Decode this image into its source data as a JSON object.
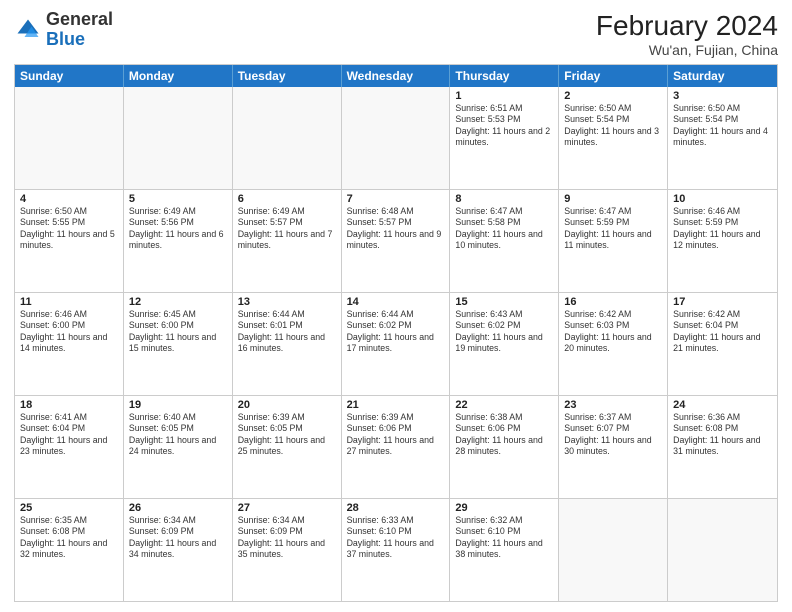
{
  "header": {
    "logo_general": "General",
    "logo_blue": "Blue",
    "month_year": "February 2024",
    "location": "Wu'an, Fujian, China"
  },
  "days_of_week": [
    "Sunday",
    "Monday",
    "Tuesday",
    "Wednesday",
    "Thursday",
    "Friday",
    "Saturday"
  ],
  "weeks": [
    [
      {
        "day": "",
        "info": ""
      },
      {
        "day": "",
        "info": ""
      },
      {
        "day": "",
        "info": ""
      },
      {
        "day": "",
        "info": ""
      },
      {
        "day": "1",
        "info": "Sunrise: 6:51 AM\nSunset: 5:53 PM\nDaylight: 11 hours and 2 minutes."
      },
      {
        "day": "2",
        "info": "Sunrise: 6:50 AM\nSunset: 5:54 PM\nDaylight: 11 hours and 3 minutes."
      },
      {
        "day": "3",
        "info": "Sunrise: 6:50 AM\nSunset: 5:54 PM\nDaylight: 11 hours and 4 minutes."
      }
    ],
    [
      {
        "day": "4",
        "info": "Sunrise: 6:50 AM\nSunset: 5:55 PM\nDaylight: 11 hours and 5 minutes."
      },
      {
        "day": "5",
        "info": "Sunrise: 6:49 AM\nSunset: 5:56 PM\nDaylight: 11 hours and 6 minutes."
      },
      {
        "day": "6",
        "info": "Sunrise: 6:49 AM\nSunset: 5:57 PM\nDaylight: 11 hours and 7 minutes."
      },
      {
        "day": "7",
        "info": "Sunrise: 6:48 AM\nSunset: 5:57 PM\nDaylight: 11 hours and 9 minutes."
      },
      {
        "day": "8",
        "info": "Sunrise: 6:47 AM\nSunset: 5:58 PM\nDaylight: 11 hours and 10 minutes."
      },
      {
        "day": "9",
        "info": "Sunrise: 6:47 AM\nSunset: 5:59 PM\nDaylight: 11 hours and 11 minutes."
      },
      {
        "day": "10",
        "info": "Sunrise: 6:46 AM\nSunset: 5:59 PM\nDaylight: 11 hours and 12 minutes."
      }
    ],
    [
      {
        "day": "11",
        "info": "Sunrise: 6:46 AM\nSunset: 6:00 PM\nDaylight: 11 hours and 14 minutes."
      },
      {
        "day": "12",
        "info": "Sunrise: 6:45 AM\nSunset: 6:00 PM\nDaylight: 11 hours and 15 minutes."
      },
      {
        "day": "13",
        "info": "Sunrise: 6:44 AM\nSunset: 6:01 PM\nDaylight: 11 hours and 16 minutes."
      },
      {
        "day": "14",
        "info": "Sunrise: 6:44 AM\nSunset: 6:02 PM\nDaylight: 11 hours and 17 minutes."
      },
      {
        "day": "15",
        "info": "Sunrise: 6:43 AM\nSunset: 6:02 PM\nDaylight: 11 hours and 19 minutes."
      },
      {
        "day": "16",
        "info": "Sunrise: 6:42 AM\nSunset: 6:03 PM\nDaylight: 11 hours and 20 minutes."
      },
      {
        "day": "17",
        "info": "Sunrise: 6:42 AM\nSunset: 6:04 PM\nDaylight: 11 hours and 21 minutes."
      }
    ],
    [
      {
        "day": "18",
        "info": "Sunrise: 6:41 AM\nSunset: 6:04 PM\nDaylight: 11 hours and 23 minutes."
      },
      {
        "day": "19",
        "info": "Sunrise: 6:40 AM\nSunset: 6:05 PM\nDaylight: 11 hours and 24 minutes."
      },
      {
        "day": "20",
        "info": "Sunrise: 6:39 AM\nSunset: 6:05 PM\nDaylight: 11 hours and 25 minutes."
      },
      {
        "day": "21",
        "info": "Sunrise: 6:39 AM\nSunset: 6:06 PM\nDaylight: 11 hours and 27 minutes."
      },
      {
        "day": "22",
        "info": "Sunrise: 6:38 AM\nSunset: 6:06 PM\nDaylight: 11 hours and 28 minutes."
      },
      {
        "day": "23",
        "info": "Sunrise: 6:37 AM\nSunset: 6:07 PM\nDaylight: 11 hours and 30 minutes."
      },
      {
        "day": "24",
        "info": "Sunrise: 6:36 AM\nSunset: 6:08 PM\nDaylight: 11 hours and 31 minutes."
      }
    ],
    [
      {
        "day": "25",
        "info": "Sunrise: 6:35 AM\nSunset: 6:08 PM\nDaylight: 11 hours and 32 minutes."
      },
      {
        "day": "26",
        "info": "Sunrise: 6:34 AM\nSunset: 6:09 PM\nDaylight: 11 hours and 34 minutes."
      },
      {
        "day": "27",
        "info": "Sunrise: 6:34 AM\nSunset: 6:09 PM\nDaylight: 11 hours and 35 minutes."
      },
      {
        "day": "28",
        "info": "Sunrise: 6:33 AM\nSunset: 6:10 PM\nDaylight: 11 hours and 37 minutes."
      },
      {
        "day": "29",
        "info": "Sunrise: 6:32 AM\nSunset: 6:10 PM\nDaylight: 11 hours and 38 minutes."
      },
      {
        "day": "",
        "info": ""
      },
      {
        "day": "",
        "info": ""
      }
    ]
  ]
}
